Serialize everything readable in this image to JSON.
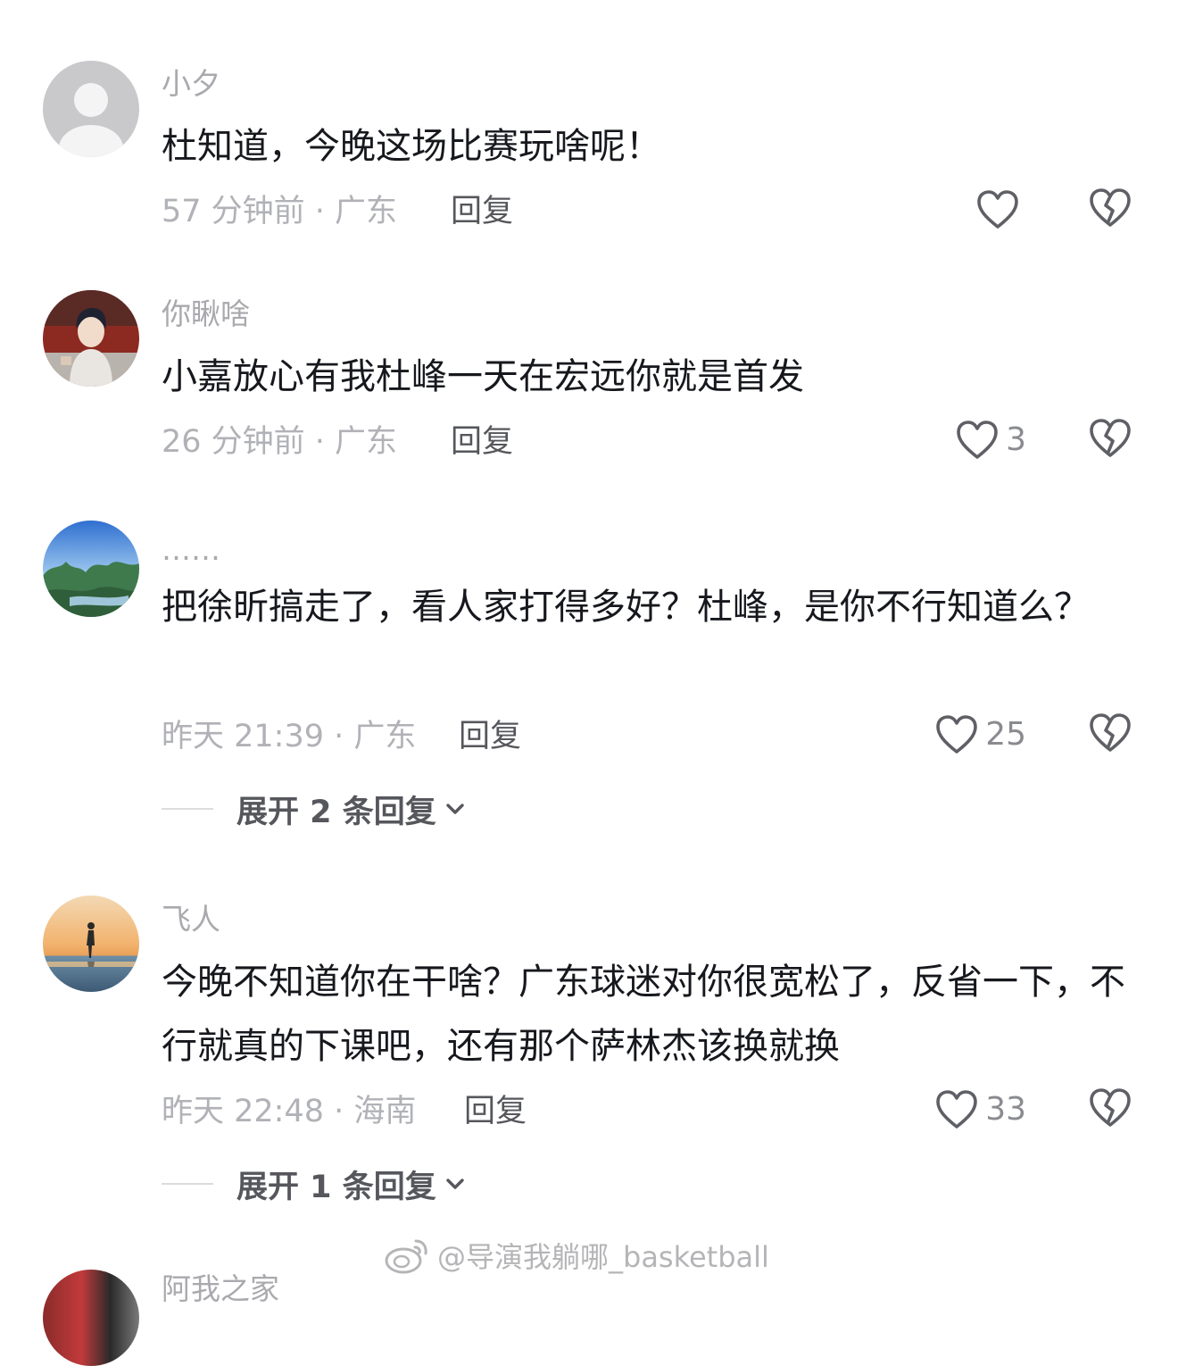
{
  "comments": [
    {
      "username": "小夕",
      "text": "杜知道，今晚这场比赛玩啥呢！",
      "meta": "57 分钟前 · 广东",
      "reply_label": "回复",
      "likes": "",
      "avatar": "default-avatar"
    },
    {
      "username": "你瞅啥",
      "text": "小嘉放心有我杜峰一天在宏远你就是首发",
      "meta": "26 分钟前 · 广东",
      "reply_label": "回复",
      "likes": "3",
      "avatar": "anime-character-avatar"
    },
    {
      "username": "……",
      "text": "把徐昕搞走了，看人家打得多好？杜峰，是你不行知道么？",
      "meta": "昨天 21:39 · 广东",
      "reply_label": "回复",
      "likes": "25",
      "avatar": "landscape-avatar",
      "expand_label": "展开 2 条回复"
    },
    {
      "username": "飞人",
      "text": "今晚不知道你在干啥？广东球迷对你很宽松了，反省一下，不行就真的下课吧，还有那个萨林杰该换就换",
      "meta": "昨天 22:48 · 海南",
      "reply_label": "回复",
      "likes": "33",
      "avatar": "sunset-figure-avatar",
      "expand_label": "展开 1 条回复"
    }
  ],
  "next_comment": {
    "username": "阿我之家"
  },
  "watermark": {
    "text": "@导演我躺哪_basketball",
    "icon": "weibo-icon"
  },
  "colors": {
    "text": "#16181d",
    "muted": "#b1b2b7",
    "icon": "#5f6066"
  }
}
